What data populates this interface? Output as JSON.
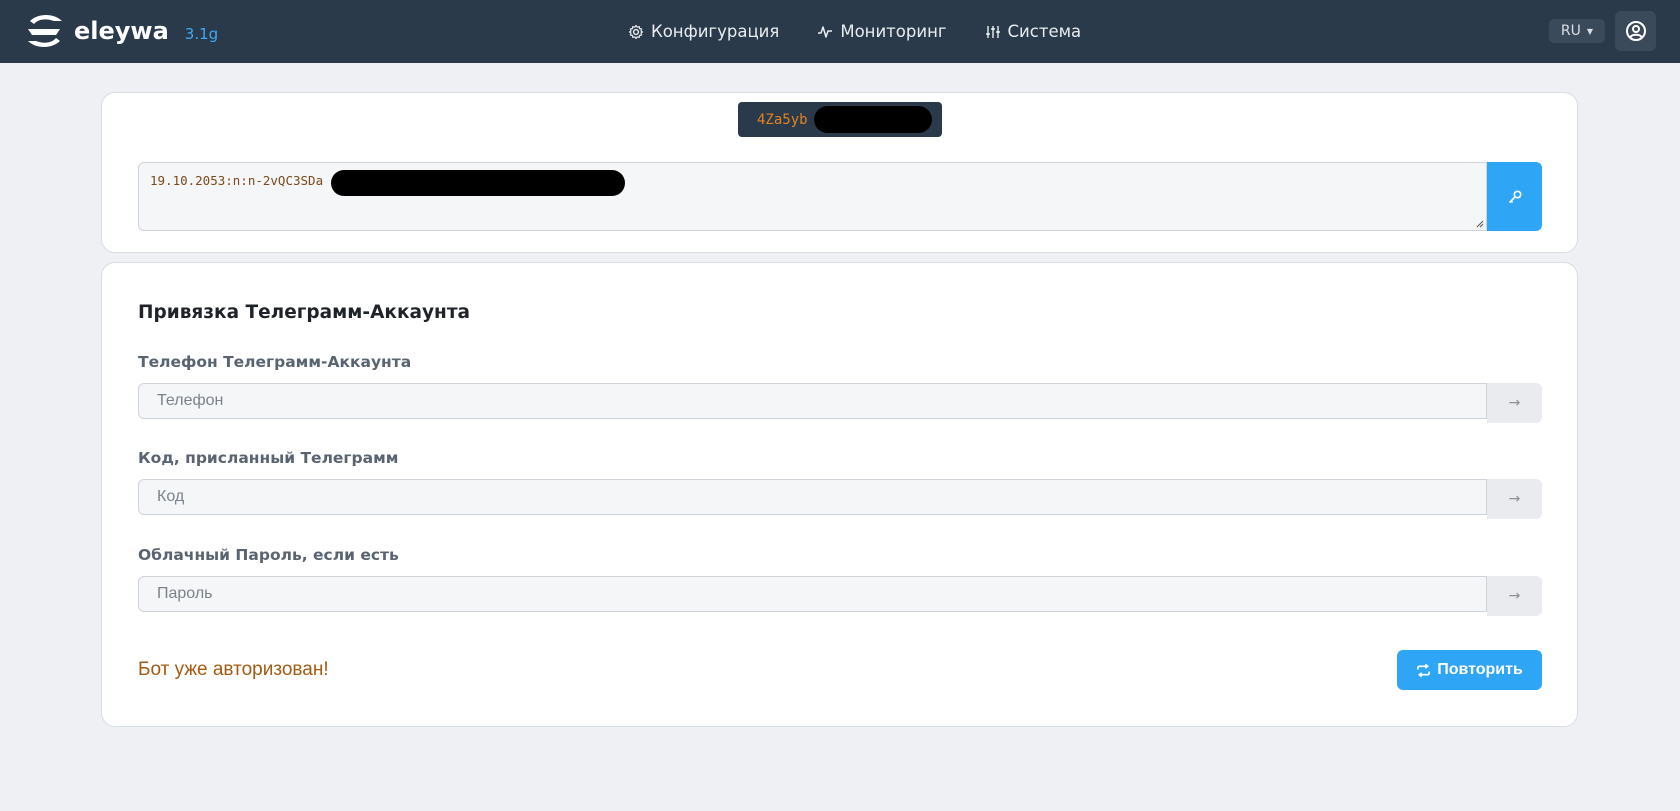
{
  "brand": {
    "name": "eleywa",
    "version": "3.1g"
  },
  "nav": {
    "items": [
      {
        "label": "Конфигурация",
        "icon": "gear-icon"
      },
      {
        "label": "Мониторинг",
        "icon": "activity-icon"
      },
      {
        "label": "Система",
        "icon": "sliders-icon"
      }
    ]
  },
  "language": {
    "selected": "RU"
  },
  "token": {
    "visible_prefix": "4Za5yb"
  },
  "key_input": {
    "value_prefix": "19.10.2053:n:n-2vQC3SDa"
  },
  "telegram": {
    "title": "Привязка Телеграмм-Аккаунта",
    "phone": {
      "label": "Телефон Телеграмм-Аккаунта",
      "placeholder": "Телефон",
      "button": "→"
    },
    "code": {
      "label": "Код, присланный Телеграмм",
      "placeholder": "Код",
      "button": "→"
    },
    "password": {
      "label": "Облачный Пароль, если есть",
      "placeholder": "Пароль",
      "button": "→"
    },
    "status": "Бот уже авторизован!",
    "retry_label": "Повторить"
  },
  "colors": {
    "navbar": "#2b3a4a",
    "accent": "#2ea6f5",
    "status": "#a35a12",
    "token": "#e3821f"
  }
}
